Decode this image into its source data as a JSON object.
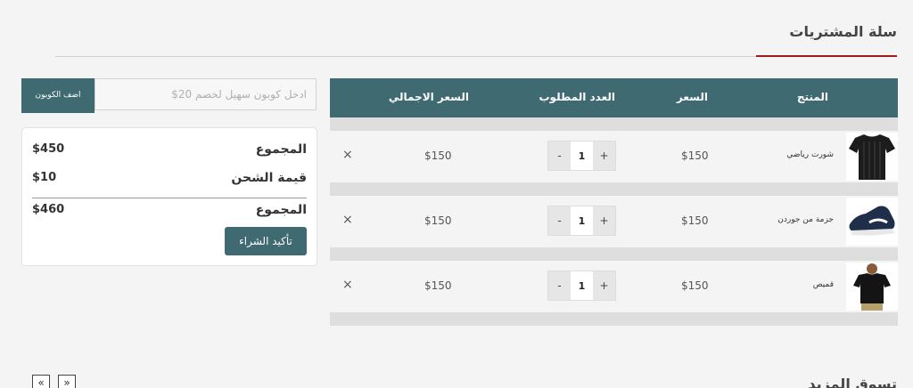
{
  "page": {
    "title": "سلة المشتريات",
    "shop_more_title": "تسوق المزيد",
    "accent_color": "#a21b1b",
    "brand_color": "#3f6a72"
  },
  "cart": {
    "headers": {
      "product": "المنتج",
      "price": "السعر",
      "quantity": "العدد المطلوب",
      "total": "السعر الاجمالي"
    },
    "items": [
      {
        "name": "شورت رياضي",
        "price": "$150",
        "qty": "1",
        "total": "$150",
        "image": "black-tshirt"
      },
      {
        "name": "جزمة من جوردن",
        "price": "$150",
        "qty": "1",
        "total": "$150",
        "image": "sneaker"
      },
      {
        "name": "قميص",
        "price": "$150",
        "qty": "1",
        "total": "$150",
        "image": "man-in-black-tshirt"
      }
    ],
    "remove_glyph": "×",
    "minus_glyph": "-",
    "plus_glyph": "+"
  },
  "coupon": {
    "placeholder": "ادخل كوبون سهيل لخصم 20$",
    "button_label": "اضف الكوبون"
  },
  "summary": {
    "subtotal_label": "المجموع",
    "subtotal_value": "$450",
    "shipping_label": "قيمة الشحن",
    "shipping_value": "$10",
    "total_label": "المجموع",
    "total_value": "$460",
    "confirm_label": "تأكيد الشراء"
  },
  "carousel": {
    "prev_glyph": "«",
    "next_glyph": "»"
  }
}
